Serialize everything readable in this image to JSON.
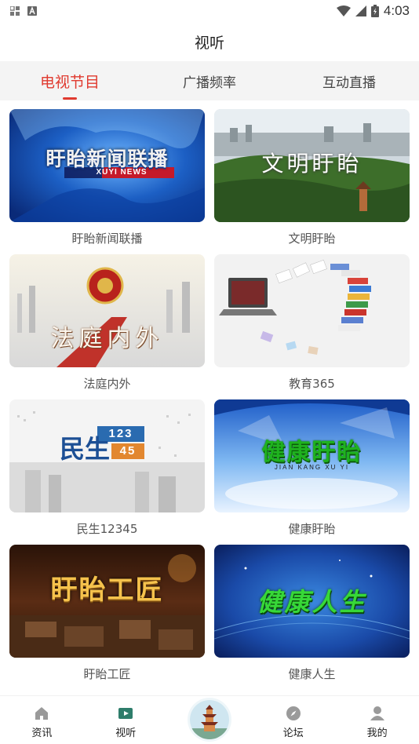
{
  "status_bar": {
    "time": "4:03"
  },
  "header": {
    "title": "视听"
  },
  "tabs": [
    {
      "label": "电视节目",
      "active": true
    },
    {
      "label": "广播频率",
      "active": false
    },
    {
      "label": "互动直播",
      "active": false
    }
  ],
  "programs": [
    {
      "title": "盱眙新闻联播",
      "thumb_text": "盱眙新闻联播",
      "thumb_sub": "XUYI NEWS"
    },
    {
      "title": "文明盱眙",
      "thumb_text": "文明盱眙"
    },
    {
      "title": "法庭内外",
      "thumb_text": "法庭内外"
    },
    {
      "title": "教育365"
    },
    {
      "title": "民生12345",
      "thumb_text": "民生",
      "thumb_sub": "123",
      "thumb_sub2": "45"
    },
    {
      "title": "健康盱眙",
      "thumb_text": "健康盱眙",
      "thumb_sub": "JIAN KANG XU YI"
    },
    {
      "title": "盱眙工匠",
      "thumb_text": "盱眙工匠"
    },
    {
      "title": "健康人生",
      "thumb_text": "健康人生"
    }
  ],
  "bottom_nav": [
    {
      "label": "资讯",
      "icon": "home-icon"
    },
    {
      "label": "视听",
      "icon": "video-icon"
    },
    {
      "label": "",
      "icon": "pagoda-icon"
    },
    {
      "label": "论坛",
      "icon": "compass-icon"
    },
    {
      "label": "我的",
      "icon": "user-icon"
    }
  ],
  "colors": {
    "accent": "#e03a2f",
    "tab_bg": "#f4f4f4"
  }
}
